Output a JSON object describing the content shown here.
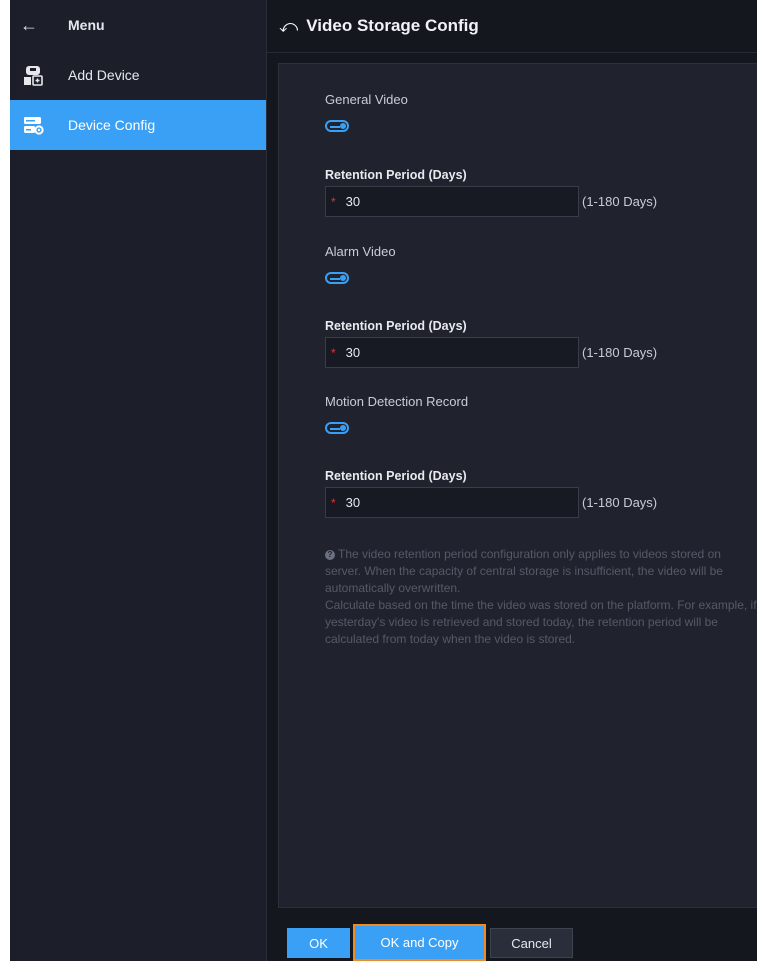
{
  "sidebar": {
    "header_label": "Menu",
    "back_icon": "left-arrow-icon",
    "items": [
      {
        "label": "Add Device",
        "icon": "add-device-icon",
        "active": false
      },
      {
        "label": "Device Config",
        "icon": "device-config-icon",
        "active": true
      }
    ]
  },
  "page": {
    "title": "Video Storage Config",
    "back_icon": "undo-arrow-icon"
  },
  "sections": [
    {
      "label": "General Video",
      "enabled": true,
      "field_label": "Retention Period (Days)",
      "required_mark": "*",
      "value": "30",
      "hint": "(1-180 Days)"
    },
    {
      "label": "Alarm Video",
      "enabled": true,
      "field_label": "Retention Period (Days)",
      "required_mark": "*",
      "value": "30",
      "hint": "(1-180 Days)"
    },
    {
      "label": "Motion Detection Record",
      "enabled": true,
      "field_label": "Retention Period (Days)",
      "required_mark": "*",
      "value": "30",
      "hint": "(1-180 Days)"
    }
  ],
  "note": {
    "icon": "help-icon",
    "line1": "The video retention period configuration only applies to videos stored on server. When the capacity of central storage is insufficient, the video will be automatically overwritten.",
    "line2": "Calculate based on the time the video was stored on the platform. For example, if yesterday's video is retrieved and stored today, the retention period will be calculated from today when the video is stored."
  },
  "footer": {
    "ok_label": "OK",
    "ok_copy_label": "OK and Copy",
    "cancel_label": "Cancel"
  },
  "colors": {
    "accent": "#3aa0f5",
    "background": "#15171f",
    "panel": "#20232e",
    "required": "#e0353b",
    "focus_outline": "#f08a24"
  }
}
